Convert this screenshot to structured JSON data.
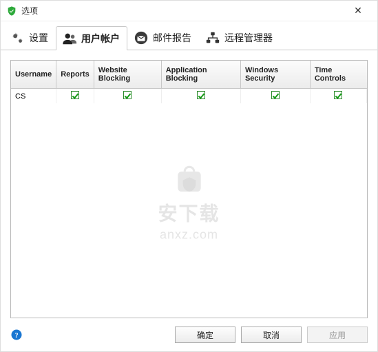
{
  "window": {
    "title": "选项"
  },
  "tabs": [
    {
      "label": "设置",
      "active": false
    },
    {
      "label": "用户帐户",
      "active": true
    },
    {
      "label": "邮件报告",
      "active": false
    },
    {
      "label": "远程管理器",
      "active": false
    }
  ],
  "table": {
    "columns": [
      "Username",
      "Reports",
      "Website Blocking",
      "Application Blocking",
      "Windows Security",
      "Time Controls"
    ],
    "rows": [
      {
        "username": "CS",
        "reports": true,
        "website_blocking": true,
        "application_blocking": true,
        "windows_security": true,
        "time_controls": true
      }
    ]
  },
  "watermark": {
    "text1": "安下载",
    "text2": "anxz.com"
  },
  "buttons": {
    "ok": "确定",
    "cancel": "取消",
    "apply": "应用"
  }
}
